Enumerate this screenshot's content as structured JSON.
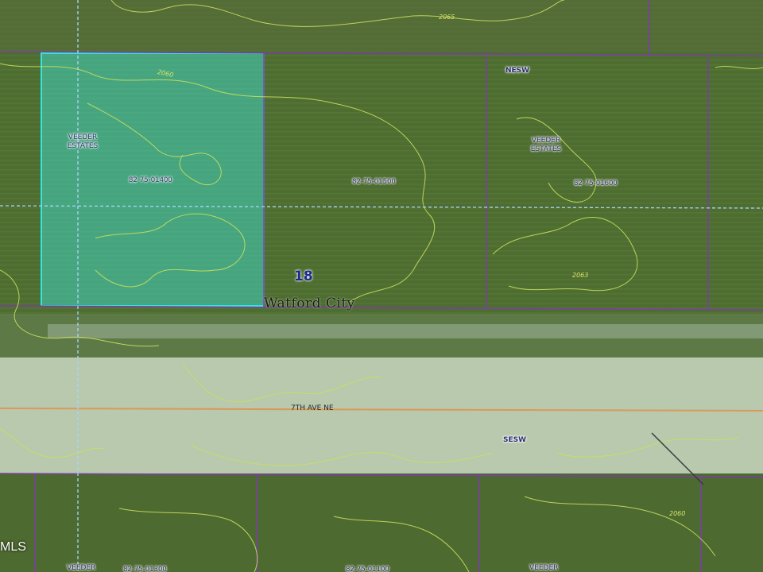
{
  "map": {
    "colors": {
      "field": "#4b6a2e",
      "road_surface": "#b8c9ae",
      "parcel_line": "#7b3fa4",
      "highlight_fill": "#3fd4c0",
      "highlight_stroke": "#33e6e6",
      "contour": "#c9df5f",
      "section_line": "#a9d4ff",
      "centerline": "#d99a59"
    },
    "parcels": [
      {
        "id": "82-75-01400"
      },
      {
        "id": "82-75-01500"
      },
      {
        "id": "82-75-01600"
      }
    ],
    "subdivision_labels": [
      "VEEDER ESTATES",
      "VEEDER ESTATES",
      "VEEDER",
      "VEEDER"
    ],
    "quarter_labels": [
      "NESW",
      "SESW"
    ],
    "section_number": "18",
    "township_label": "Watford City",
    "road_name": "7TH AVE NE",
    "elevation_labels": [
      "2065",
      "2060",
      "2063",
      "2060"
    ],
    "watermark": "MLS",
    "bottom_parcel_fragments": [
      "82-75-01300",
      "82-75-01100"
    ]
  }
}
